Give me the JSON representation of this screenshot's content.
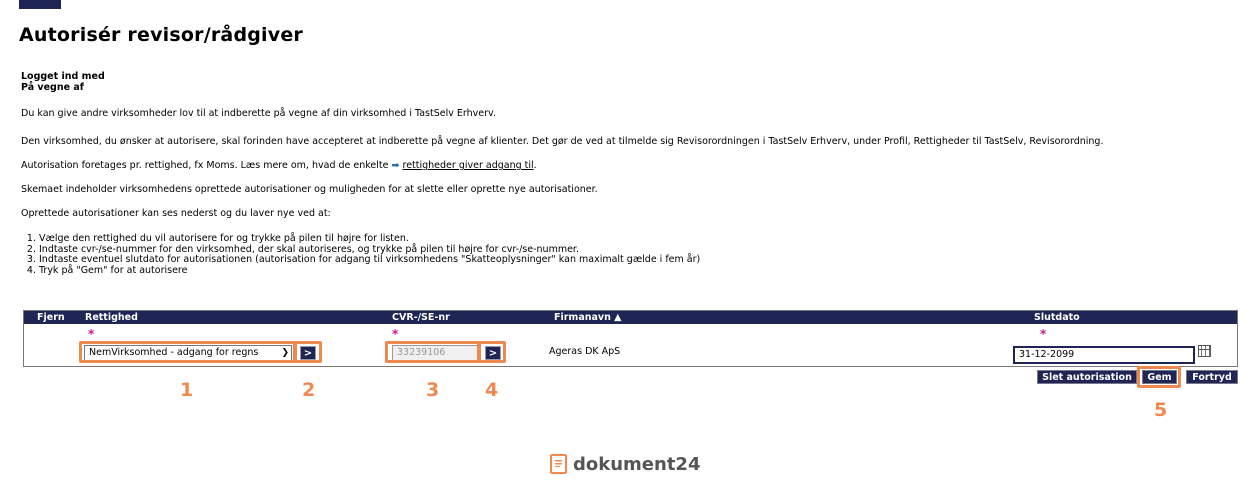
{
  "page": {
    "title": "Autorisér revisor/rådgiver",
    "login_line1": "Logget ind med",
    "login_line2": "På vegne af"
  },
  "intro": {
    "p1": "Du kan give andre virksomheder lov til at indberette på vegne af din virksomhed i TastSelv Erhverv.",
    "p2": "Den virksomhed, du ønsker at autorisere, skal forinden have accepteret at indberette på vegne af klienter. Det gør de ved at tilmelde sig Revisorordningen i TastSelv Erhverv, under Profil, Rettigheder til TastSelv, Revisorordning.",
    "p3_before": "Autorisation foretages pr. rettighed, fx Moms. Læs mere om, hvad de enkelte",
    "p3_arrow": "➡",
    "p3_link": "rettigheder giver adgang til",
    "p3_after": ".",
    "p4": "Skemaet indeholder virksomhedens oprettede autorisationer og muligheden for at slette eller oprette nye autorisationer.",
    "p5": "Oprettede autorisationer kan ses nederst og du laver nye ved at:"
  },
  "steps": [
    "Vælge den rettighed du vil autorisere for og trykke på pilen til højre for listen.",
    "Indtaste cvr-/se-nummer for den virksomhed, der skal autoriseres, og trykke på pilen til højre for cvr-/se-nummer.",
    "Indtaste eventuel slutdato for autorisationen (autorisation for adgang til virksomhedens \"Skatteoplysninger\" kan maximalt gælde i fem år)",
    "Tryk på \"Gem\" for at autorisere"
  ],
  "grid": {
    "headers": {
      "fjern": "Fjern",
      "rettighed": "Rettighed",
      "cvr": "CVR-/SE-nr",
      "firmanavn": "Firmanavn ▲",
      "slutdato": "Slutdato"
    },
    "required_mark": "*",
    "rettighed_value": "NemVirksomhed - adgang for regns",
    "go_label": ">",
    "cvr_value": "33239106",
    "firmanavn_value": "Ageras DK ApS",
    "slutdato_value": "31-12-2099"
  },
  "buttons": {
    "delete": "Slet autorisation",
    "save": "Gem",
    "cancel": "Fortryd"
  },
  "callouts": [
    "1",
    "2",
    "3",
    "4",
    "5"
  ],
  "footer": {
    "brand": "dokument24"
  },
  "colors": {
    "header_bg": "#1f2554",
    "highlight": "#f0894f",
    "required": "#c0208c"
  }
}
